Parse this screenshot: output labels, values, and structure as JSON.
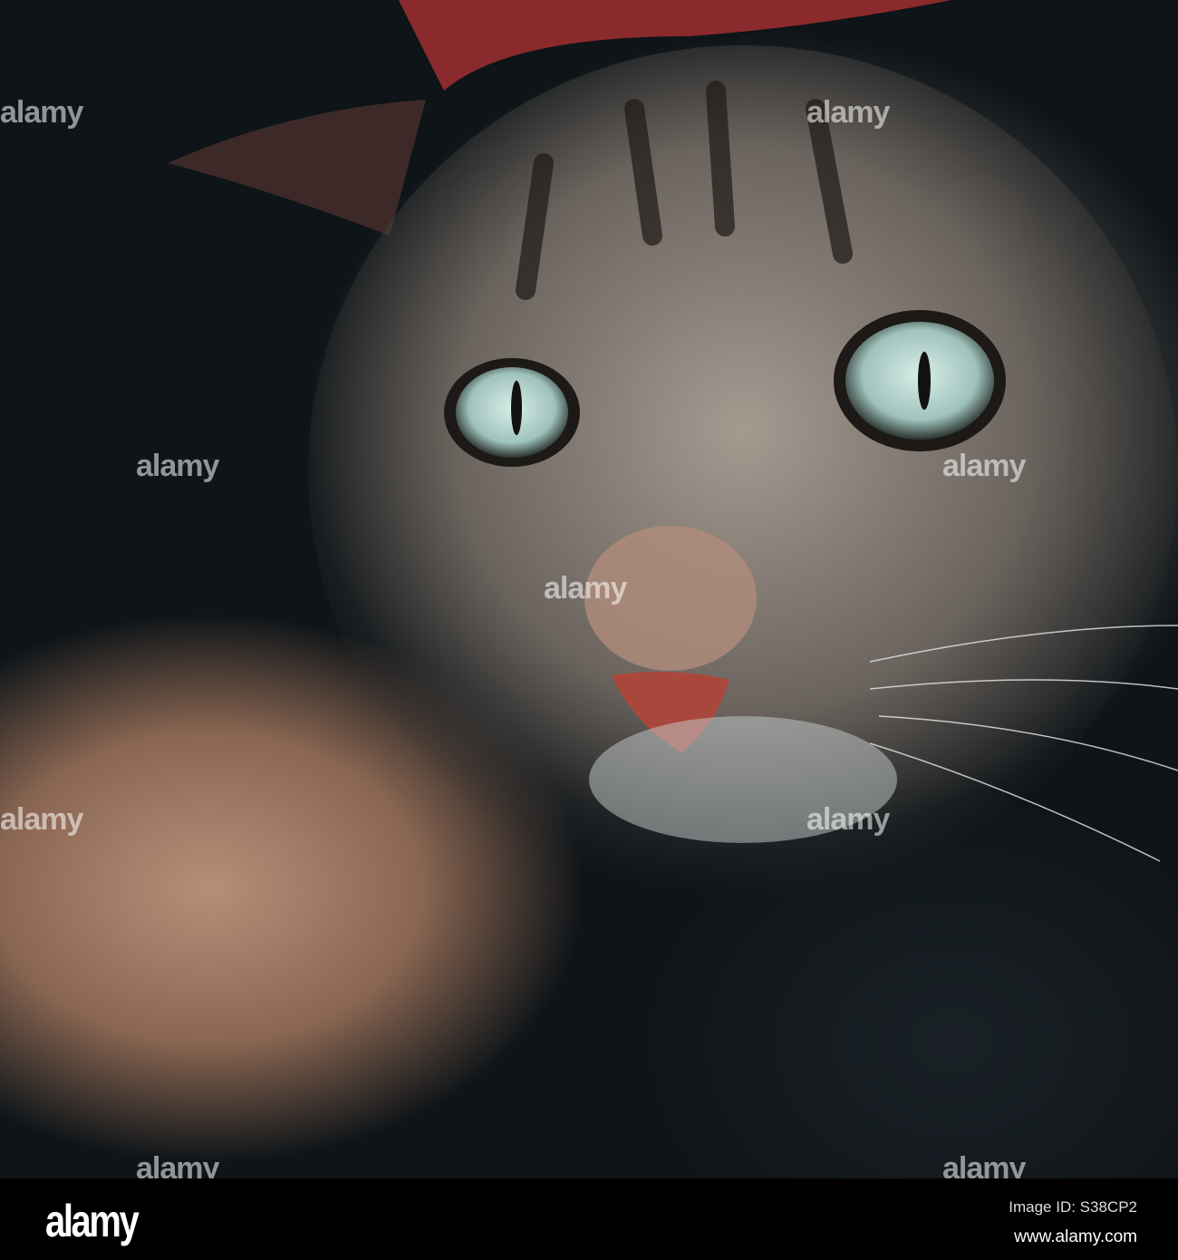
{
  "photo": {
    "subject": "Tabby cat close-up",
    "watermark": "alamy"
  },
  "footer": {
    "logo": "alamy",
    "image_id": "Image ID: S38CP2",
    "url": "www.alamy.com"
  }
}
